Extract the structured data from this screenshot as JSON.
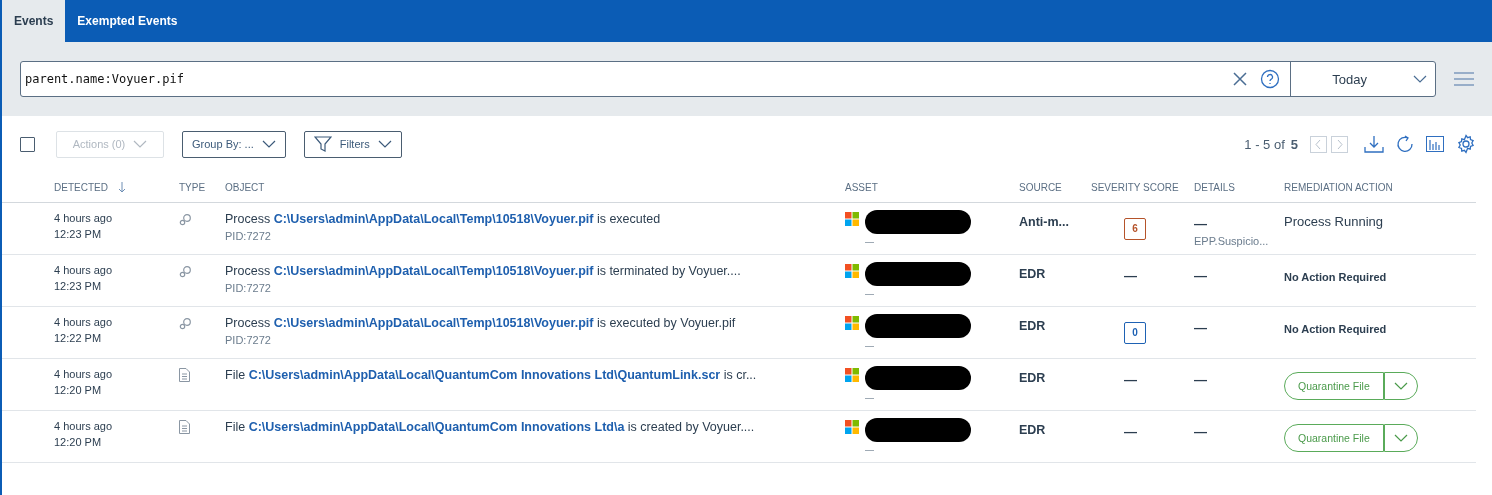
{
  "tabs": [
    {
      "label": "Events",
      "selected": true
    },
    {
      "label": "Exempted Events",
      "selected": false
    }
  ],
  "search": {
    "value": "parent.name:Voyuer.pif",
    "range": "Today"
  },
  "toolbar": {
    "actions": "Actions (0)",
    "actions_disabled": true,
    "group_by": "Group By: ...",
    "filters": "Filters",
    "select_all_checked": false
  },
  "pagination": {
    "range": "1 - 5 of",
    "total": "5"
  },
  "table": {
    "columns": [
      {
        "label": "DETECTED",
        "sorted": true
      },
      {
        "label": "TYPE",
        "sorted": false
      },
      {
        "label": "OBJECT",
        "sorted": false
      },
      {
        "label": "ASSET",
        "sorted": false
      },
      {
        "label": "SOURCE",
        "sorted": false
      },
      {
        "label": "SEVERITY SCORE",
        "sorted": false
      },
      {
        "label": "DETAILS",
        "sorted": false
      },
      {
        "label": "REMEDIATION ACTION",
        "sorted": false
      }
    ],
    "rows": [
      {
        "ago": "4 hours ago",
        "time": "12:23 PM",
        "kind": "process",
        "object": "Process **C:\\Users\\admin\\AppData\\Local\\Temp\\10518\\Voyuer.pif** is executed",
        "pid": "PID:7272",
        "asset_sub": "—",
        "source": "Anti-m...",
        "severity": {
          "score": "6",
          "color": "#b5532a"
        },
        "details": "—",
        "details_sub": "EPP.Suspicio...",
        "remediation": {
          "kind": "status",
          "label": "Process Running"
        }
      },
      {
        "ago": "4 hours ago",
        "time": "12:23 PM",
        "kind": "process",
        "object": "Process **C:\\Users\\admin\\AppData\\Local\\Temp\\10518\\Voyuer.pif** is terminated by Voyuer....",
        "pid": "PID:7272",
        "asset_sub": "—",
        "source": "EDR",
        "severity": {
          "score": "—"
        },
        "details": "—",
        "remediation": {
          "kind": "note",
          "label": "No Action Required"
        }
      },
      {
        "ago": "4 hours ago",
        "time": "12:22 PM",
        "kind": "process",
        "object": "Process **C:\\Users\\admin\\AppData\\Local\\Temp\\10518\\Voyuer.pif** is executed by Voyuer.pif",
        "pid": "PID:7272",
        "asset_sub": "—",
        "source": "EDR",
        "severity": {
          "score": "0",
          "color": "#1e62b4"
        },
        "details": "—",
        "remediation": {
          "kind": "note",
          "label": "No Action Required"
        }
      },
      {
        "ago": "4 hours ago",
        "time": "12:20 PM",
        "kind": "file",
        "object": "File **C:\\Users\\admin\\AppData\\Local\\QuantumCom Innovations Ltd\\QuantumLink.scr** is cr...",
        "asset_sub": "—",
        "source": "EDR",
        "severity": {
          "score": "—"
        },
        "details": "—",
        "remediation": {
          "kind": "button",
          "label": "Quarantine File"
        }
      },
      {
        "ago": "4 hours ago",
        "time": "12:20 PM",
        "kind": "file",
        "object": "File **C:\\Users\\admin\\AppData\\Local\\QuantumCom Innovations Ltd\\a** is created by Voyuer....",
        "asset_sub": "—",
        "source": "EDR",
        "severity": {
          "score": "—"
        },
        "details": "—",
        "remediation": {
          "kind": "button",
          "label": "Quarantine File"
        }
      }
    ]
  }
}
